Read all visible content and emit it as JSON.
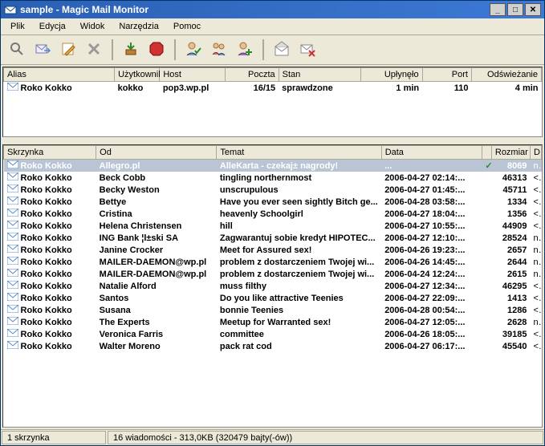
{
  "window": {
    "title_prefix": "sample",
    "title_app": " - Magic Mail Monitor"
  },
  "menu": [
    "Plik",
    "Edycja",
    "Widok",
    "Narzędzia",
    "Pomoc"
  ],
  "accounts": {
    "headers": [
      "Alias",
      "Użytkownik",
      "Host",
      "Poczta",
      "Stan",
      "Upłynęło",
      "Port",
      "Odświeżanie"
    ],
    "rows": [
      {
        "alias": "Roko Kokko",
        "user": "kokko",
        "host": "pop3.wp.pl",
        "mail": "16/15",
        "state": "sprawdzone",
        "elapsed": "1 min",
        "port": "110",
        "refresh": "4 min"
      }
    ]
  },
  "messages": {
    "headers": [
      "Skrzynka",
      "Od",
      "Temat",
      "Data",
      "",
      "Rozmiar",
      "D"
    ],
    "rows": [
      {
        "box": "Roko Kokko",
        "from": "Allegro.pl",
        "subject": "AlleKarta - czekaj± nagrody!",
        "date": "...",
        "size": "8069",
        "d": "n",
        "selected": true
      },
      {
        "box": "Roko Kokko",
        "from": "Beck Cobb",
        "subject": "tingling northernmost",
        "date": "2006-04-27 02:14:...",
        "size": "46313",
        "d": "<"
      },
      {
        "box": "Roko Kokko",
        "from": "Becky Weston",
        "subject": "unscrupulous",
        "date": "2006-04-27 01:45:...",
        "size": "45711",
        "d": "<"
      },
      {
        "box": "Roko Kokko",
        "from": "Bettye",
        "subject": "Have you ever seen sightly Bitch ge...",
        "date": "2006-04-28 03:58:...",
        "size": "1334",
        "d": "<"
      },
      {
        "box": "Roko Kokko",
        "from": "Cristina",
        "subject": "heavenly Schoolgirl",
        "date": "2006-04-27 18:04:...",
        "size": "1356",
        "d": "<"
      },
      {
        "box": "Roko Kokko",
        "from": "Helena Christensen",
        "subject": "hill",
        "date": "2006-04-27 10:55:...",
        "size": "44909",
        "d": "<"
      },
      {
        "box": "Roko Kokko",
        "from": "ING Bank ¦l±ski SA",
        "subject": "Zagwarantuj sobie kredyt HIPOTEC...",
        "date": "2006-04-27 12:10:...",
        "size": "28524",
        "d": "n"
      },
      {
        "box": "Roko Kokko",
        "from": "Janine Crocker",
        "subject": "Meet for Assured sex!",
        "date": "2006-04-26 19:23:...",
        "size": "2657",
        "d": "n"
      },
      {
        "box": "Roko Kokko",
        "from": "MAILER-DAEMON@wp.pl",
        "subject": "problem z dostarczeniem Twojej wi...",
        "date": "2006-04-26 14:45:...",
        "size": "2644",
        "d": "n"
      },
      {
        "box": "Roko Kokko",
        "from": "MAILER-DAEMON@wp.pl",
        "subject": "problem z dostarczeniem Twojej wi...",
        "date": "2006-04-24 12:24:...",
        "size": "2615",
        "d": "n"
      },
      {
        "box": "Roko Kokko",
        "from": "Natalie Alford",
        "subject": "muss filthy",
        "date": "2006-04-27 12:34:...",
        "size": "46295",
        "d": "<"
      },
      {
        "box": "Roko Kokko",
        "from": "Santos",
        "subject": "Do you like attractive Teenies",
        "date": "2006-04-27 22:09:...",
        "size": "1413",
        "d": "<"
      },
      {
        "box": "Roko Kokko",
        "from": "Susana",
        "subject": "bonnie Teenies",
        "date": "2006-04-28 00:54:...",
        "size": "1286",
        "d": "<"
      },
      {
        "box": "Roko Kokko",
        "from": "The Experts",
        "subject": "Meetup for Warranted sex!",
        "date": "2006-04-27 12:05:...",
        "size": "2628",
        "d": "n"
      },
      {
        "box": "Roko Kokko",
        "from": "Veronica Farris",
        "subject": "committee",
        "date": "2006-04-26 18:05:...",
        "size": "39185",
        "d": "<"
      },
      {
        "box": "Roko Kokko",
        "from": "Walter Moreno",
        "subject": "pack rat cod",
        "date": "2006-04-27 06:17:...",
        "size": "45540",
        "d": "<"
      }
    ]
  },
  "status": {
    "left": "1 skrzynka",
    "right": "16 wiadomości - 313,0KB (320479 bajty(-ów))"
  },
  "toolbar_icons": [
    "search",
    "forward",
    "compose",
    "delete",
    "|",
    "download",
    "stop",
    "|",
    "user-check",
    "users",
    "user-add",
    "|",
    "mail-open",
    "mail-delete"
  ]
}
